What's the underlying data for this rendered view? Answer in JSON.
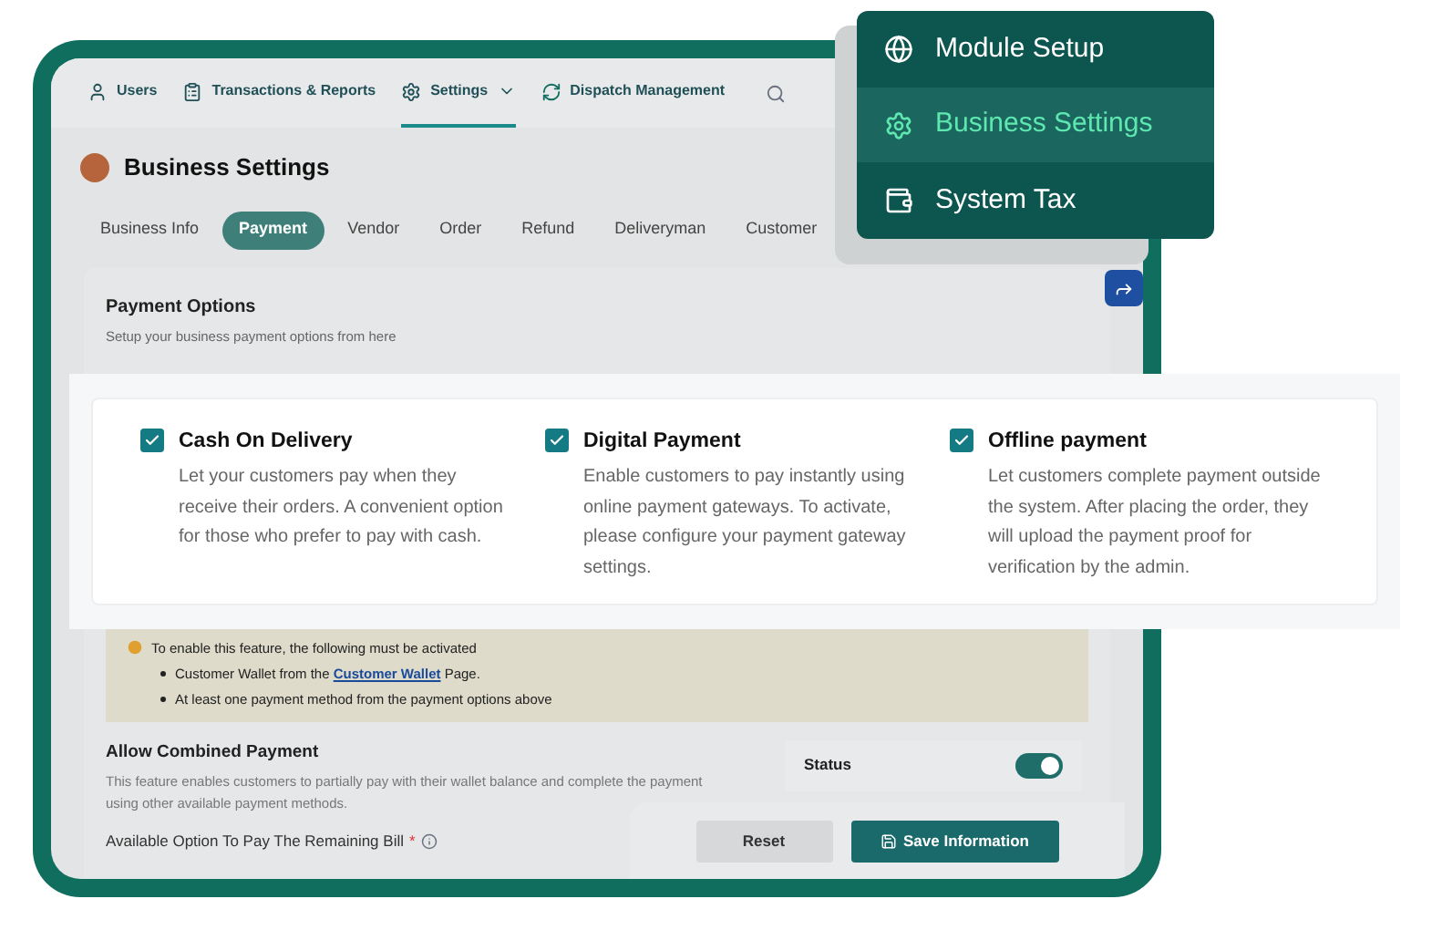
{
  "nav": [
    {
      "label": "Users",
      "selected": false,
      "dropdown": false
    },
    {
      "label": "Transactions & Reports",
      "selected": false,
      "dropdown": false
    },
    {
      "label": "Settings",
      "selected": true,
      "dropdown": true
    },
    {
      "label": "Dispatch Management",
      "selected": false,
      "dropdown": false
    }
  ],
  "page_title": "Business Settings",
  "tabs": [
    {
      "label": "Business Info",
      "selected": false
    },
    {
      "label": "Payment",
      "selected": true
    },
    {
      "label": "Vendor",
      "selected": false
    },
    {
      "label": "Order",
      "selected": false
    },
    {
      "label": "Refund",
      "selected": false
    },
    {
      "label": "Deliveryman",
      "selected": false
    },
    {
      "label": "Customer",
      "selected": false
    }
  ],
  "menu": [
    {
      "label": "Module Setup",
      "selected": false
    },
    {
      "label": "Business Settings",
      "selected": true
    },
    {
      "label": "System Tax",
      "selected": false
    }
  ],
  "payment_options": {
    "title": "Payment Options",
    "subtitle": "Setup your business payment options from here"
  },
  "options": [
    {
      "title": "Cash On Delivery",
      "description": "Let your customers pay when they receive their orders. A convenient option for those who prefer to pay with cash.",
      "checked": true
    },
    {
      "title": "Digital Payment",
      "description": "Enable customers to pay instantly using online payment gateways. To activate, please configure your payment gateway settings.",
      "checked": true
    },
    {
      "title": "Offline payment",
      "description": "Let customers complete payment outside the system. After placing the order, they will upload the payment proof for verification by the admin.",
      "checked": true
    }
  ],
  "notice": {
    "heading": "To enable this feature, the following must be activated",
    "items": [
      {
        "before": "Customer Wallet from the ",
        "link": "Customer Wallet",
        "after": " Page."
      },
      {
        "before": "At least one payment method from the payment options above"
      }
    ]
  },
  "combined_payment": {
    "title": "Allow Combined Payment",
    "description": "This feature enables customers to partially pay with their wallet balance and complete the payment using other available payment methods.",
    "field_label": "Available Option To Pay The Remaining Bill",
    "required_mark": "*",
    "status_label": "Status",
    "status_on": true
  },
  "buttons": {
    "reset": "Reset",
    "save": "Save Information"
  }
}
